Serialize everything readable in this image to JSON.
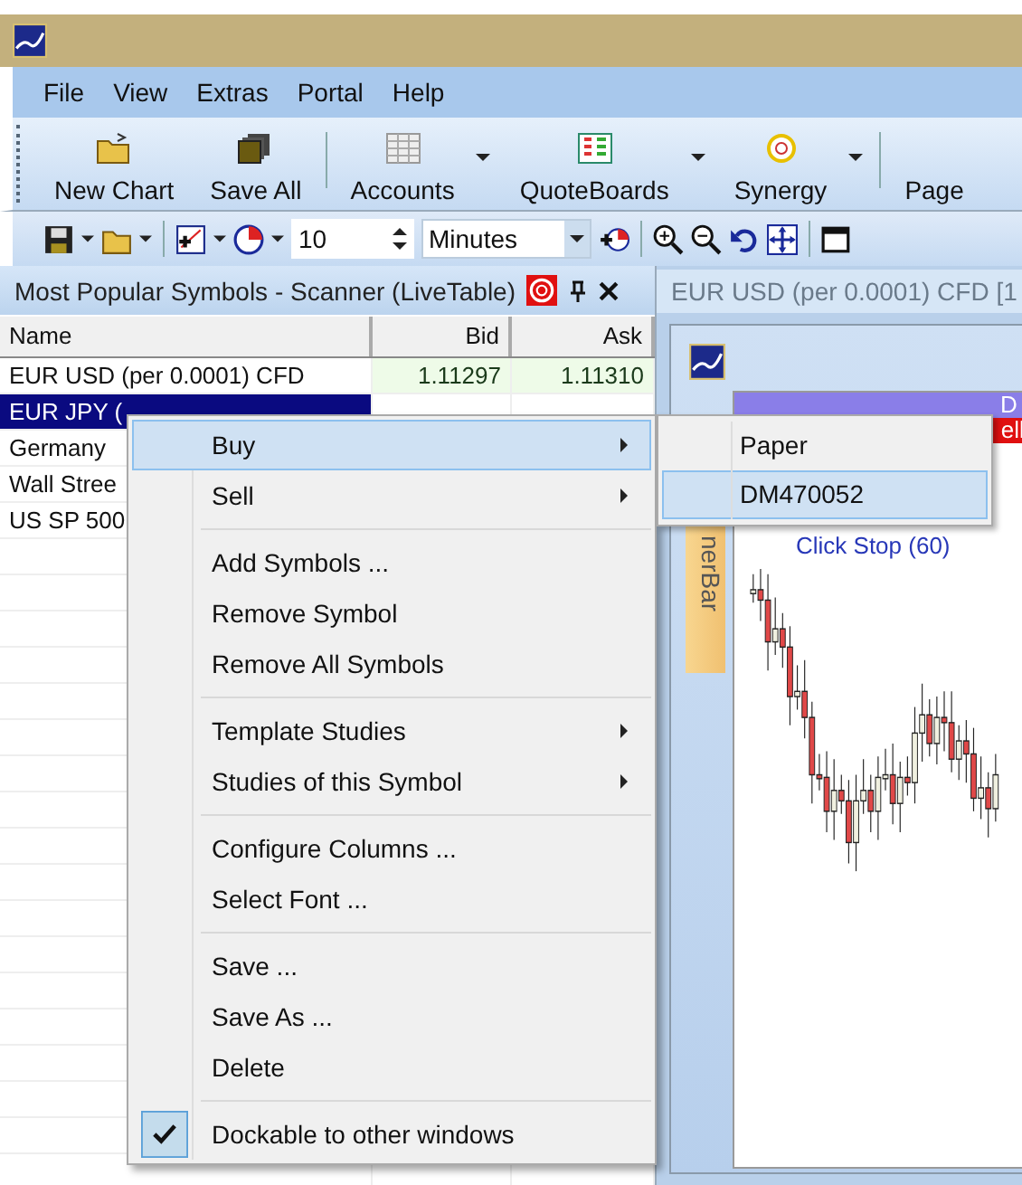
{
  "menu_bar": [
    "File",
    "View",
    "Extras",
    "Portal",
    "Help"
  ],
  "toolbar": [
    {
      "label": "New Chart",
      "dropdown": false
    },
    {
      "label": "Save All",
      "dropdown": false
    },
    {
      "label": "Accounts",
      "dropdown": true
    },
    {
      "label": "QuoteBoards",
      "dropdown": true
    },
    {
      "label": "Synergy",
      "dropdown": true
    },
    {
      "label": "Page",
      "dropdown": false
    }
  ],
  "toolbar2": {
    "interval_value": "10",
    "interval_unit": "Minutes"
  },
  "scanner": {
    "title": "Most Popular Symbols - Scanner (LiveTable)",
    "columns": [
      "Name",
      "Bid",
      "Ask"
    ],
    "rows": [
      {
        "name": "EUR USD (per 0.0001) CFD",
        "bid": "1.11297",
        "ask": "1.11310",
        "selected": false
      },
      {
        "name": "EUR JPY (",
        "selected": true
      },
      {
        "name": "Germany",
        "selected": false
      },
      {
        "name": "Wall Stree",
        "selected": false
      },
      {
        "name": "US SP 500",
        "selected": false
      }
    ]
  },
  "chart": {
    "tab": "EUR USD (per 0.0001) CFD [1",
    "side_tab": "nerBar",
    "header_fragment": "D",
    "sell_fragment": "ell",
    "lines": [
      "Click Stop  (60)"
    ]
  },
  "context_menu": {
    "groups": [
      [
        {
          "label": "Buy",
          "submenu": true,
          "selected": true,
          "checked": false
        },
        {
          "label": "Sell",
          "submenu": true,
          "selected": false,
          "checked": false
        }
      ],
      [
        {
          "label": "Add Symbols ...",
          "submenu": false,
          "selected": false,
          "checked": false
        },
        {
          "label": "Remove Symbol",
          "submenu": false,
          "selected": false,
          "checked": false
        },
        {
          "label": "Remove All Symbols",
          "submenu": false,
          "selected": false,
          "checked": false
        }
      ],
      [
        {
          "label": "Template Studies",
          "submenu": true,
          "selected": false,
          "checked": false
        },
        {
          "label": "Studies of this Symbol",
          "submenu": true,
          "selected": false,
          "checked": false
        }
      ],
      [
        {
          "label": "Configure Columns ...",
          "submenu": false,
          "selected": false,
          "checked": false
        },
        {
          "label": "Select Font ...",
          "submenu": false,
          "selected": false,
          "checked": false
        }
      ],
      [
        {
          "label": "Save ...",
          "submenu": false,
          "selected": false,
          "checked": false
        },
        {
          "label": "Save As ...",
          "submenu": false,
          "selected": false,
          "checked": false
        },
        {
          "label": "Delete",
          "submenu": false,
          "selected": false,
          "checked": false
        }
      ],
      [
        {
          "label": "Dockable to other windows",
          "submenu": false,
          "selected": false,
          "checked": true
        }
      ]
    ]
  },
  "submenu": [
    {
      "label": "Paper",
      "selected": false
    },
    {
      "label": "DM470052",
      "selected": true
    }
  ]
}
